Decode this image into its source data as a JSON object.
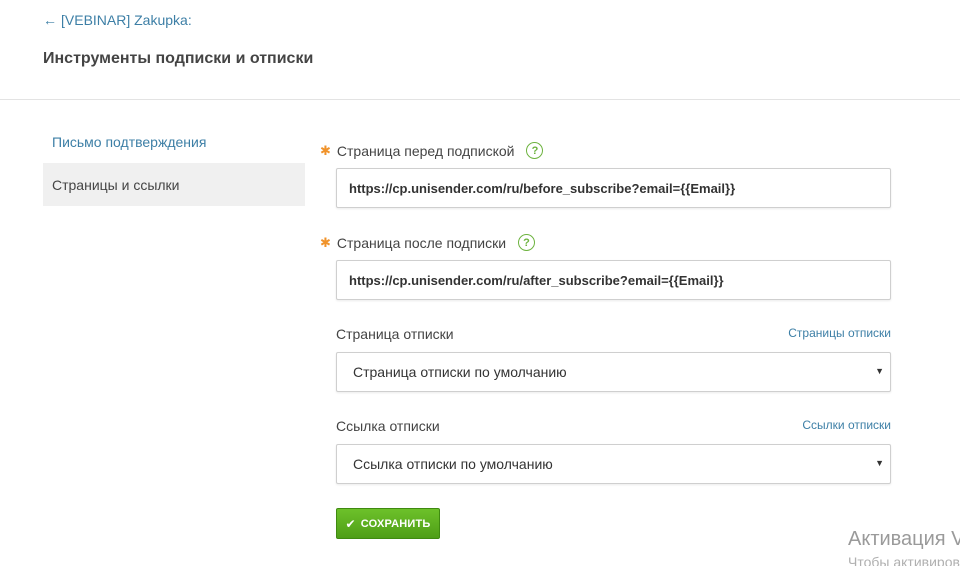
{
  "header": {
    "back_arrow": "←",
    "back_label": "[VEBINAR] Zakupka:",
    "title": "Инструменты подписки и отписки"
  },
  "sidebar": {
    "items": [
      {
        "label": "Письмо подтверждения"
      },
      {
        "label": "Страницы и ссылки"
      }
    ]
  },
  "form": {
    "before_subscribe": {
      "required_mark": "✱",
      "label": "Страница перед подпиской",
      "help": "?",
      "value": "https://cp.unisender.com/ru/before_subscribe?email={{Email}}"
    },
    "after_subscribe": {
      "required_mark": "✱",
      "label": "Страница после подписки",
      "help": "?",
      "value": "https://cp.unisender.com/ru/after_subscribe?email={{Email}}"
    },
    "unsubscribe_page": {
      "label": "Страница отписки",
      "link": "Страницы отписки",
      "selected": "Страница отписки по умолчанию"
    },
    "unsubscribe_link": {
      "label": "Ссылка отписки",
      "link": "Ссылки отписки",
      "selected": "Ссылка отписки по умолчанию"
    },
    "save_label": "СОХРАНИТЬ"
  },
  "watermark": {
    "line1": "Активация V",
    "line2": "Чтобы активиров"
  },
  "colors": {
    "link": "#3d7fa6",
    "required": "#f0932b",
    "help": "#6db33f",
    "save_button": "#5aae1f"
  },
  "icons": {
    "back": "arrow-left-icon",
    "help": "question-circle-icon",
    "caret": "caret-down-icon",
    "check": "check-icon"
  }
}
